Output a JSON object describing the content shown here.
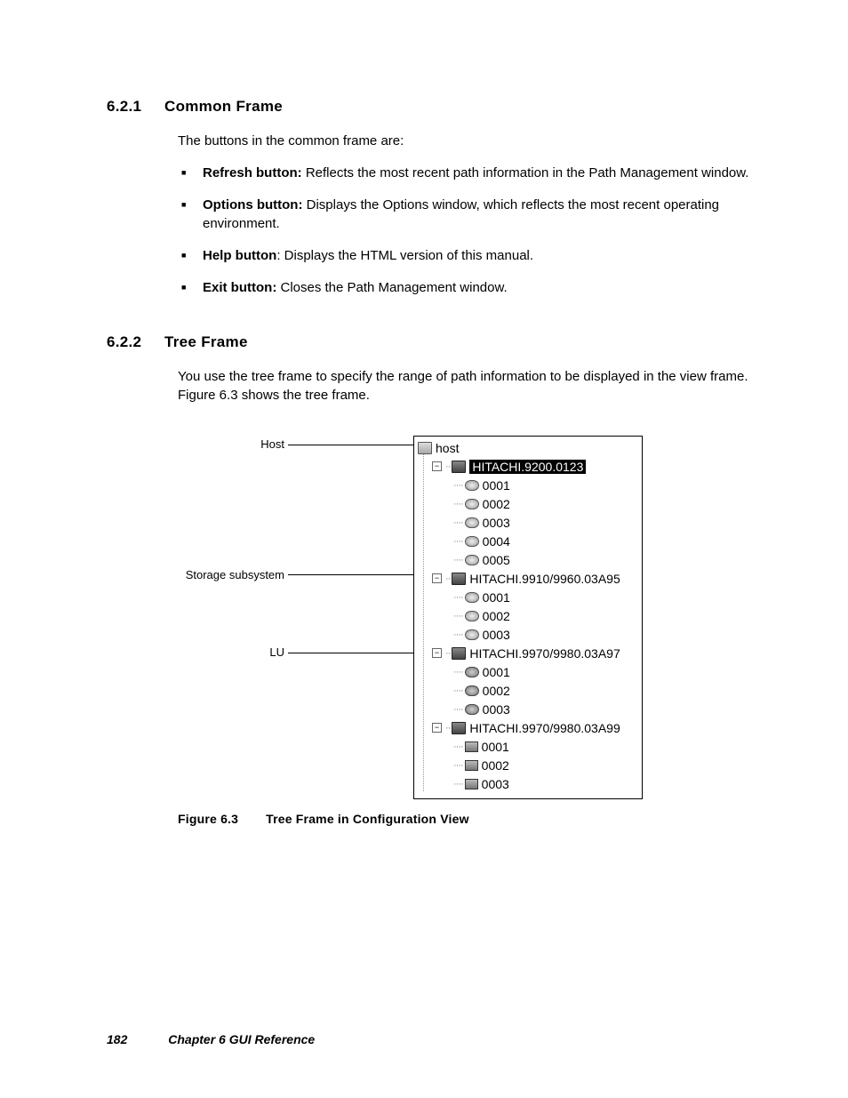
{
  "section1": {
    "num": "6.2.1",
    "title": "Common Frame",
    "intro": "The buttons in the common frame are:",
    "bullets": [
      {
        "label": "Refresh button:",
        "desc": " Reflects the most recent path information in the Path Management window."
      },
      {
        "label": "Options button:",
        "desc": " Displays the Options window, which reflects the most recent operating environment."
      },
      {
        "label": "Help button",
        "desc": ": Displays the HTML version of this manual."
      },
      {
        "label": "Exit button:",
        "desc": " Closes the Path Management window."
      }
    ]
  },
  "section2": {
    "num": "6.2.2",
    "title": "Tree Frame",
    "para": "You use the tree frame to specify the range of path information to be displayed in the view frame. Figure 6.3 shows the tree frame."
  },
  "figure": {
    "annotations": {
      "host": "Host",
      "storage": "Storage subsystem",
      "lu": "LU"
    },
    "root": "host",
    "subs": [
      {
        "name": "HITACHI.9200.0123",
        "lus": [
          "0001",
          "0002",
          "0003",
          "0004",
          "0005"
        ],
        "selected": true,
        "iconA": "sub",
        "iconB": "disk"
      },
      {
        "name": "HITACHI.9910/9960.03A95",
        "lus": [
          "0001",
          "0002",
          "0003"
        ],
        "selected": false,
        "iconA": "sub",
        "iconB": "disk"
      },
      {
        "name": "HITACHI.9970/9980.03A97",
        "lus": [
          "0001",
          "0002",
          "0003"
        ],
        "selected": false,
        "iconA": "sub2",
        "iconB": "diskg"
      },
      {
        "name": "HITACHI.9970/9980.03A99",
        "lus": [
          "0001",
          "0002",
          "0003"
        ],
        "selected": false,
        "iconA": "sub2",
        "iconB": "box"
      }
    ],
    "caption_num": "Figure 6.3",
    "caption_text": "Tree Frame in Configuration View"
  },
  "footer": {
    "page": "182",
    "chapter": "Chapter 6   GUI  Reference"
  }
}
